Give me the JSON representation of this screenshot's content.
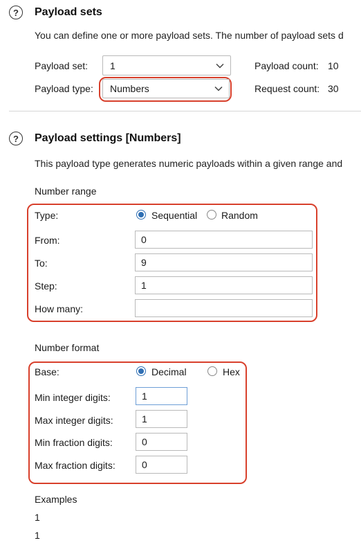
{
  "payload_sets": {
    "title": "Payload sets",
    "description": "You can define one or more payload sets. The number of payload sets d",
    "payload_set_label": "Payload set:",
    "payload_set_value": "1",
    "payload_type_label": "Payload type:",
    "payload_type_value": "Numbers",
    "payload_count_label": "Payload count:",
    "payload_count_value": "10",
    "request_count_label": "Request count:",
    "request_count_value": "30"
  },
  "payload_settings": {
    "title": "Payload settings [Numbers]",
    "description": "This payload type generates numeric payloads within a given range and",
    "number_range": {
      "heading": "Number range",
      "type_label": "Type:",
      "sequential_label": "Sequential",
      "random_label": "Random",
      "selected": "Sequential",
      "from_label": "From:",
      "from_value": "0",
      "to_label": "To:",
      "to_value": "9",
      "step_label": "Step:",
      "step_value": "1",
      "how_many_label": "How many:",
      "how_many_value": ""
    },
    "number_format": {
      "heading": "Number format",
      "base_label": "Base:",
      "decimal_label": "Decimal",
      "hex_label": "Hex",
      "selected": "Decimal",
      "min_int_label": "Min integer digits:",
      "min_int_value": "1",
      "max_int_label": "Max integer digits:",
      "max_int_value": "1",
      "min_frac_label": "Min fraction digits:",
      "min_frac_value": "0",
      "max_frac_label": "Max fraction digits:",
      "max_frac_value": "0"
    },
    "examples": {
      "heading": "Examples",
      "items": [
        "1",
        "1"
      ]
    }
  },
  "colors": {
    "highlight": "#d8402c",
    "radio_accent": "#2f6fb3",
    "focus_border": "#6d9ed6"
  }
}
